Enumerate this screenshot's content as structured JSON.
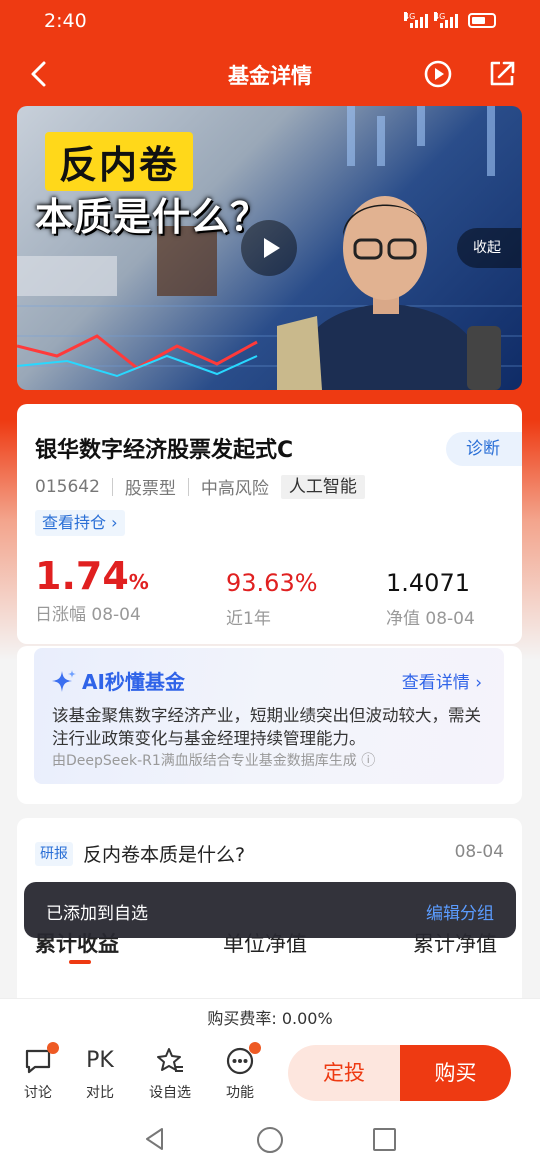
{
  "status": {
    "time": "2:40",
    "net1": "4G",
    "net2": "4G"
  },
  "header": {
    "title": "基金详情"
  },
  "video": {
    "title_line1": "反内卷",
    "title_line2": "本质是什么？",
    "collapse_label": "收起"
  },
  "fund": {
    "name": "银华数字经济股票发起式C",
    "diagnose_label": "诊断",
    "code": "015642",
    "type": "股票型",
    "risk": "中高风险",
    "theme_tag": "人工智能",
    "holdings_label": "查看持仓 ›",
    "metrics": [
      {
        "value": "1.74",
        "unit": "%",
        "label": "日涨幅 08-04"
      },
      {
        "value": "93.63%",
        "label": "近1年"
      },
      {
        "value": "1.4071",
        "label": "净值 08-04"
      }
    ]
  },
  "ai": {
    "title": "AI秒懂基金",
    "more_label": "查看详情 ›",
    "body": "该基金聚焦数字经济产业，短期业绩突出但波动较大，需关注行业政策变化与基金经理持续管理能力。",
    "footer": "由DeepSeek-R1满血版结合专业基金数据库生成 ⓘ"
  },
  "research": {
    "tag": "研报",
    "title": "反内卷本质是什么?",
    "date": "08-04"
  },
  "tabs": [
    "累计收益",
    "单位净值",
    "累计净值"
  ],
  "toast": {
    "text": "已添加到自选",
    "action": "编辑分组"
  },
  "fee": {
    "text": "购买费率: 0.00%"
  },
  "actions": [
    {
      "label": "讨论",
      "icon": "chat-icon"
    },
    {
      "label": "对比",
      "icon": "pk-icon",
      "glyph": "PK"
    },
    {
      "label": "设自选",
      "icon": "star-list-icon"
    },
    {
      "label": "功能",
      "icon": "more-icon"
    }
  ],
  "buttons": {
    "fixed_invest": "定投",
    "buy": "购买"
  },
  "colors": {
    "brand": "#ee3a12",
    "rise": "#e02020",
    "link": "#2a6fd6",
    "ai": "#2f63e8"
  }
}
